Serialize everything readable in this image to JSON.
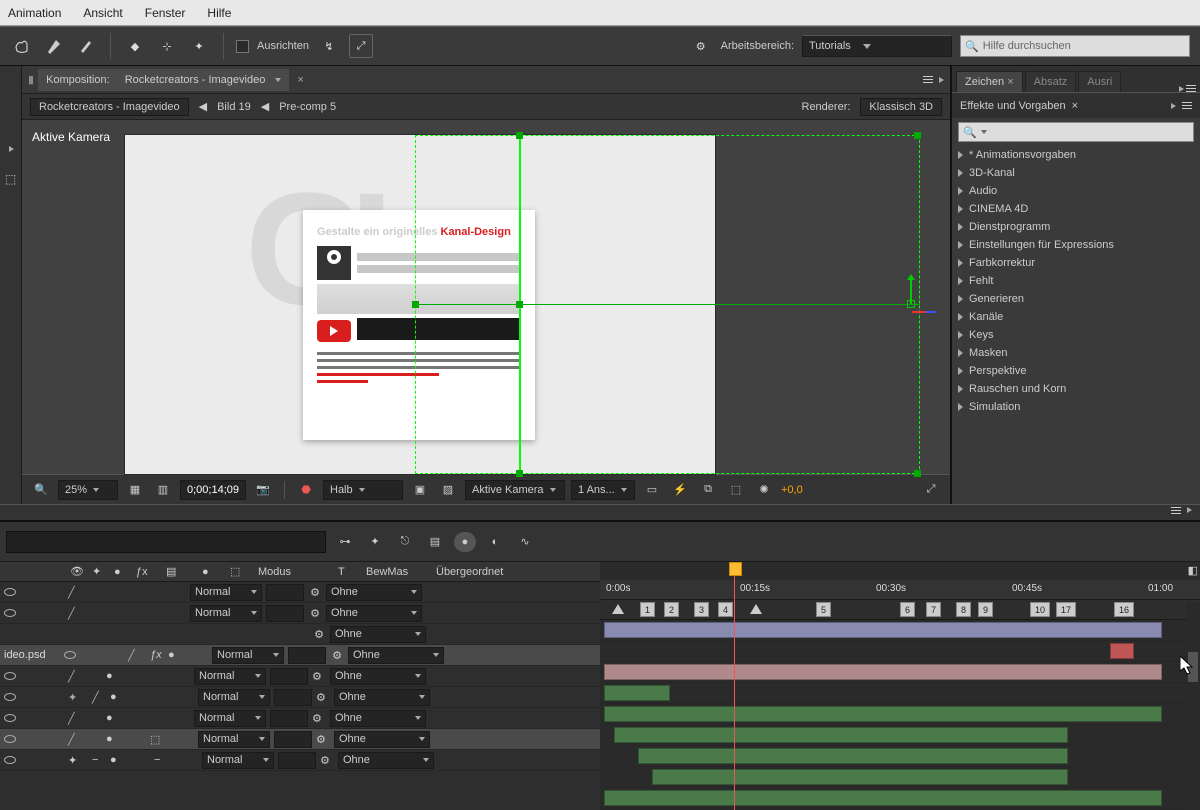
{
  "menu": {
    "items": [
      "Animation",
      "Ansicht",
      "Fenster",
      "Hilfe"
    ]
  },
  "toolbar": {
    "align_label": "Ausrichten",
    "workspace_label": "Arbeitsbereich:",
    "workspace_value": "Tutorials",
    "search_placeholder": "Hilfe durchsuchen"
  },
  "comp": {
    "tab_prefix": "Komposition:",
    "tab_name": "Rocketcreators - Imagevideo",
    "breadcrumb": [
      "Rocketcreators - Imagevideo",
      "Bild 19",
      "Pre-comp 5"
    ],
    "renderer_label": "Renderer:",
    "renderer_value": "Klassisch 3D",
    "camera_label": "Aktive Kamera",
    "page_headline_a": "Gestalte ein originelles ",
    "page_headline_b": "Kanal-Design"
  },
  "vpfoot": {
    "zoom": "25%",
    "timecode": "0;00;14;09",
    "res": "Halb",
    "view": "Aktive Kamera",
    "views": "1 Ans...",
    "exposure": "+0,0"
  },
  "side": {
    "tabs": [
      "Zeichen",
      "Absatz",
      "Ausri"
    ],
    "panel": "Effekte und Vorgaben",
    "items": [
      "* Animationsvorgaben",
      "3D-Kanal",
      "Audio",
      "CINEMA 4D",
      "Dienstprogramm",
      "Einstellungen für Expressions",
      "Farbkorrektur",
      "Fehlt",
      "Generieren",
      "Kanäle",
      "Keys",
      "Masken",
      "Perspektive",
      "Rauschen und Korn",
      "Simulation"
    ]
  },
  "tl": {
    "col_modus": "Modus",
    "col_t": "T",
    "col_bew": "BewMas",
    "col_parent": "Übergeordnet",
    "mode": "Normal",
    "parent": "Ohne",
    "filename": "ideo.psd",
    "ruler": [
      "0:00s",
      "00:15s",
      "00:30s",
      "00:45s",
      "01:00"
    ],
    "markers": [
      "1",
      "2",
      "3",
      "4",
      "5",
      "6",
      "7",
      "8",
      "9",
      "10",
      "17",
      "16"
    ]
  }
}
